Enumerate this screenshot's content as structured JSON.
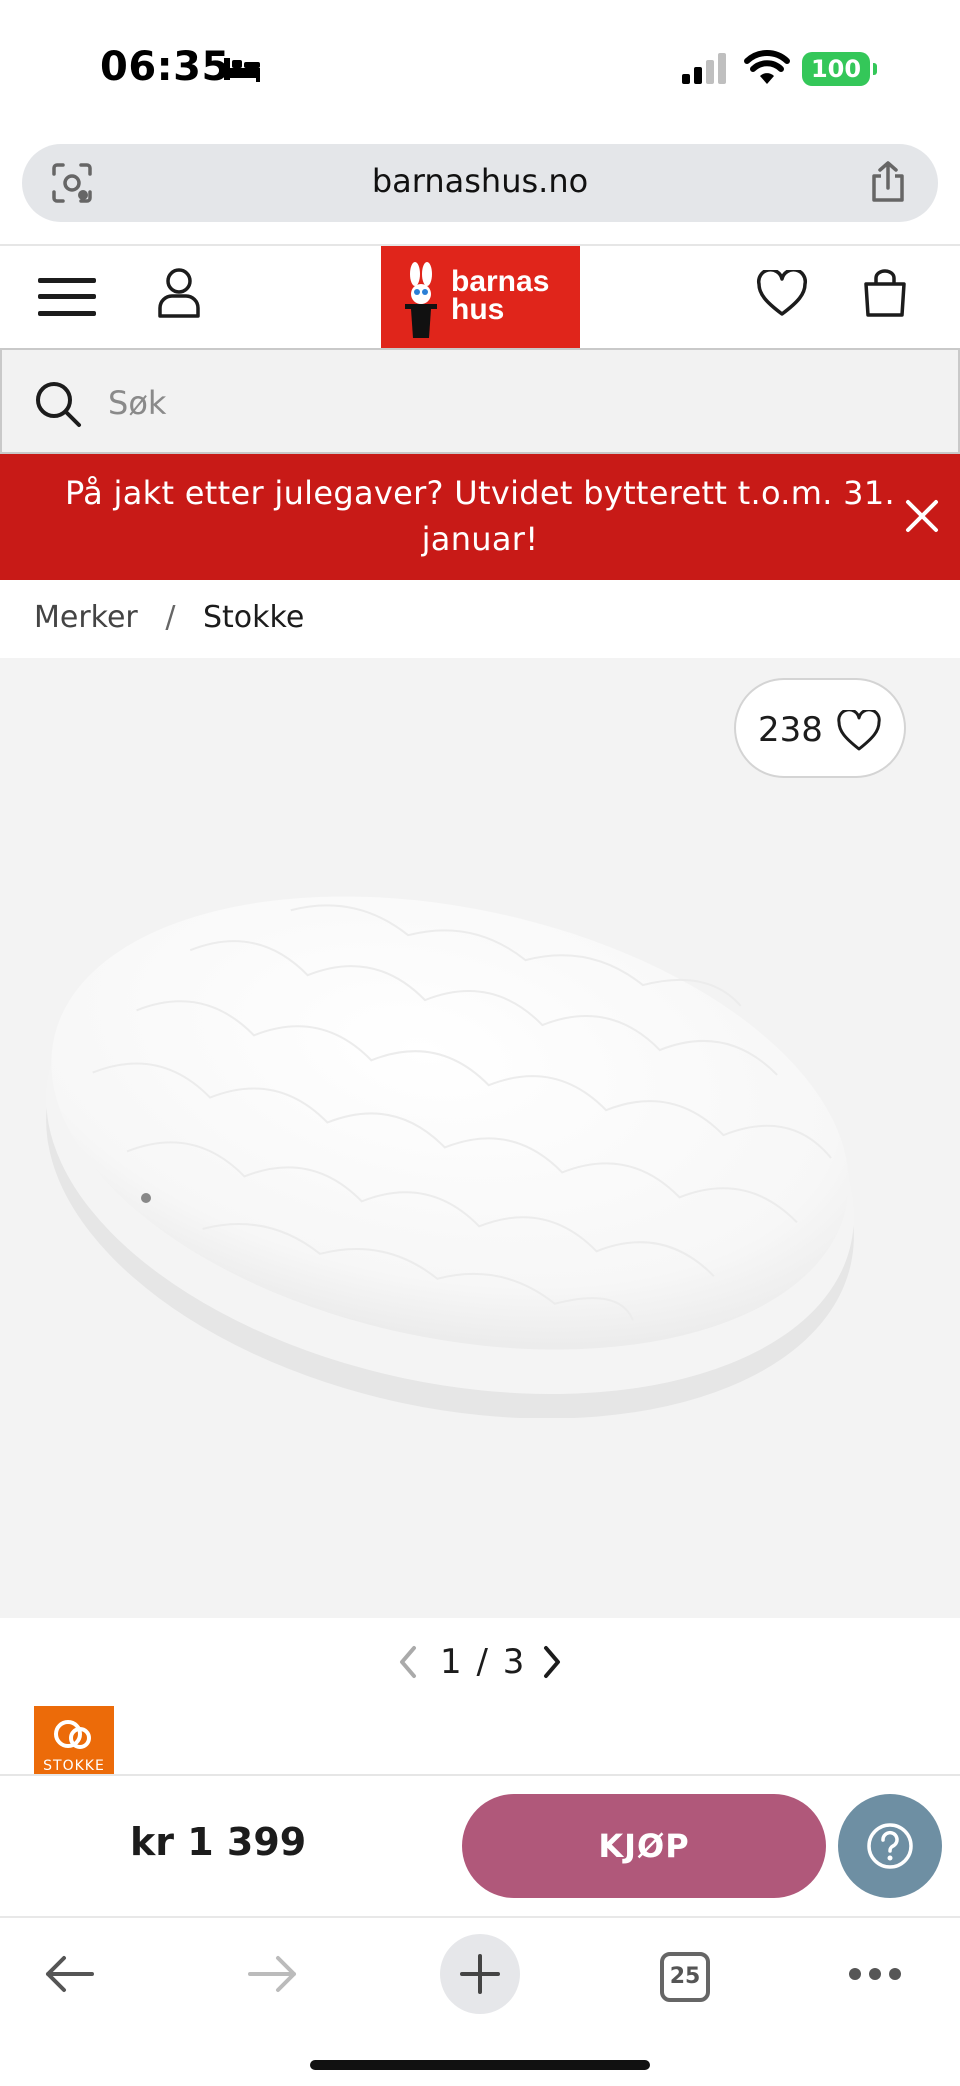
{
  "status_bar": {
    "time": "06:35",
    "battery": "100"
  },
  "url_bar": {
    "url": "barnashus.no"
  },
  "header": {
    "logo_line1": "barnas",
    "logo_line2": "hus"
  },
  "search": {
    "placeholder": "Søk"
  },
  "promo": {
    "text": "På jakt etter julegaver? Utvidet bytterett t.o.m. 31. januar!"
  },
  "breadcrumb": {
    "items": [
      "Merker",
      "Stokke"
    ],
    "separator": "/"
  },
  "product": {
    "favorites_count": "238",
    "image_pager": "1 / 3",
    "brand_logo_text": "STOKKE",
    "price": "kr 1 399",
    "buy_label": "KJØP"
  },
  "toolbar": {
    "tabs_count": "25"
  },
  "colors": {
    "brand_red": "#e0251b",
    "promo_red": "#c81a17",
    "buy_button": "#b0587a",
    "help_button": "#6e8fa3",
    "stokke_orange": "#ec6b09",
    "battery_green": "#34c759"
  }
}
